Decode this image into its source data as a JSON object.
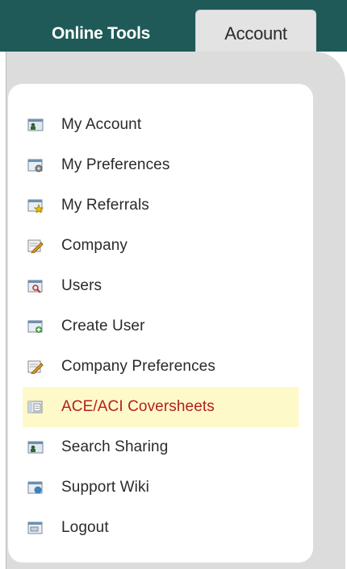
{
  "tabs": [
    {
      "label": "Online Tools"
    },
    {
      "label": "Account"
    }
  ],
  "menu": {
    "items": [
      {
        "label": "My Account",
        "icon": "user-card-icon"
      },
      {
        "label": "My Preferences",
        "icon": "window-gear-icon"
      },
      {
        "label": "My Referrals",
        "icon": "window-star-icon"
      },
      {
        "label": "Company",
        "icon": "edit-pencil-icon"
      },
      {
        "label": "Users",
        "icon": "window-search-icon"
      },
      {
        "label": "Create User",
        "icon": "window-add-icon"
      },
      {
        "label": "Company Preferences",
        "icon": "edit-pencil-icon"
      },
      {
        "label": "ACE/ACI Coversheets",
        "icon": "document-icon",
        "active": true
      },
      {
        "label": "Search Sharing",
        "icon": "user-card-icon"
      },
      {
        "label": "Support Wiki",
        "icon": "globe-window-icon"
      },
      {
        "label": "Logout",
        "icon": "window-exit-icon"
      }
    ]
  },
  "colors": {
    "topbar": "#1f5a58",
    "active_text": "#b3201f",
    "active_bg": "#fef9c8"
  }
}
